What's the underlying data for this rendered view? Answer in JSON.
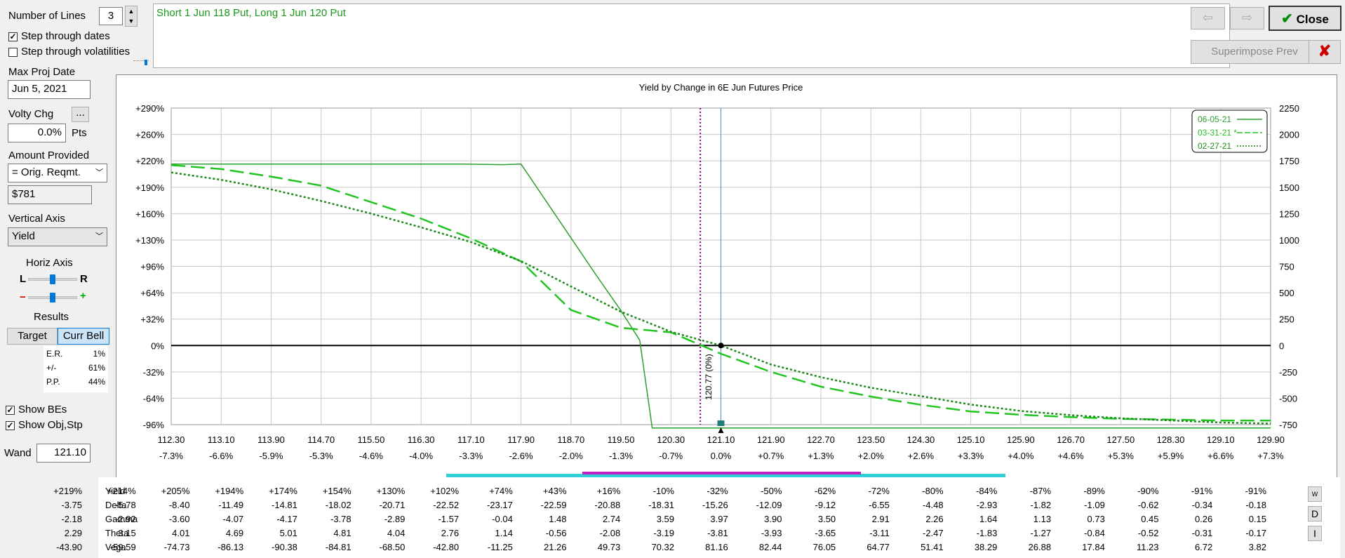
{
  "controls": {
    "num_lines_label": "Number of Lines",
    "num_lines_value": "3",
    "step_dates_label": "Step through dates",
    "step_dates_checked": true,
    "step_vols_label": "Step through volatilities",
    "step_vols_checked": false,
    "max_proj_date_label": "Max Proj Date",
    "max_proj_date_value": "Jun 5, 2021",
    "volty_chg_label": "Volty Chg",
    "volty_btn_label": "...",
    "volty_value": "0.0%",
    "volty_unit": "Pts",
    "amount_label": "Amount Provided",
    "amount_select": "= Orig. Reqmt.",
    "amount_value": "$781",
    "vaxis_label": "Vertical Axis",
    "vaxis_select": "Yield",
    "haxis_label": "Horiz Axis",
    "haxis_left": "L",
    "haxis_right": "R",
    "zoom_minus": "−",
    "zoom_plus": "+",
    "results_label": "Results",
    "target_btn": "Target",
    "curr_bell_btn": "Curr Bell",
    "er_label": "E.R.",
    "er_value": "1%",
    "pm_label": "+/-",
    "pm_value": "61%",
    "pp_label": "P.P.",
    "pp_value": "44%",
    "show_bes_label": "Show BEs",
    "show_bes_checked": true,
    "show_obj_label": "Show Obj,Stp",
    "show_obj_checked": true,
    "wand_label": "Wand",
    "wand_value": "121.10"
  },
  "position_text": "Short 1 Jun 118 Put, Long 1 Jun 120 Put",
  "toolbar": {
    "back_icon": "arrow-left-icon",
    "fwd_icon": "arrow-right-icon",
    "close_label": "Close",
    "close_icon": "checkmark-icon",
    "superimpose_label": "Superimpose Prev",
    "cancel_icon": "red-x-icon"
  },
  "chart_data": {
    "type": "line",
    "title": "Yield by Change in 6E Jun Futures Price",
    "x_ticks": [
      "112.30",
      "113.10",
      "113.90",
      "114.70",
      "115.50",
      "116.30",
      "117.10",
      "117.90",
      "118.70",
      "119.50",
      "120.30",
      "121.10",
      "121.90",
      "122.70",
      "123.50",
      "124.30",
      "125.10",
      "125.90",
      "126.70",
      "127.50",
      "128.30",
      "129.10",
      "129.90"
    ],
    "x_pct_ticks": [
      "-7.3%",
      "-6.6%",
      "-5.9%",
      "-5.3%",
      "-4.6%",
      "-4.0%",
      "-3.3%",
      "-2.6%",
      "-2.0%",
      "-1.3%",
      "-0.7%",
      "0.0%",
      "+0.7%",
      "+1.3%",
      "+2.0%",
      "+2.6%",
      "+3.3%",
      "+4.0%",
      "+4.6%",
      "+5.3%",
      "+5.9%",
      "+6.6%",
      "+7.3%"
    ],
    "y_left_ticks": [
      "+290%",
      "+260%",
      "+220%",
      "+190%",
      "+160%",
      "+130%",
      "+96%",
      "+64%",
      "+32%",
      "0%",
      "-32%",
      "-64%",
      "-96%"
    ],
    "y_right_ticks": [
      "2250",
      "2000",
      "1750",
      "1500",
      "1250",
      "1000",
      "750",
      "500",
      "250",
      "0",
      "-250",
      "-500",
      "-750"
    ],
    "xlim": [
      112.3,
      129.9
    ],
    "ylim_dollars": [
      -750,
      2250
    ],
    "grid": true,
    "legend_position": "top-right",
    "series": [
      {
        "name": "06-05-21",
        "style": "solid",
        "color": "#2e9e2e",
        "x": [
          112.3,
          116.0,
          117.0,
          117.6,
          117.9,
          118.3,
          118.7,
          119.1,
          119.5,
          119.8,
          120.0,
          121.1,
          129.9
        ],
        "y": [
          1719,
          1719,
          1719,
          1714,
          1719,
          1370,
          1020,
          670,
          330,
          50,
          -781,
          -781,
          -781
        ]
      },
      {
        "name": "03-31-21 *",
        "style": "dashed",
        "color": "#22c422",
        "x": [
          112.3,
          113.1,
          113.9,
          114.7,
          115.5,
          116.3,
          117.1,
          117.9,
          118.7,
          119.5,
          120.3,
          121.1,
          121.9,
          122.7,
          123.5,
          124.3,
          125.1,
          125.9,
          126.7,
          127.5,
          128.3,
          129.1,
          129.9
        ],
        "y": [
          1710,
          1672,
          1601,
          1515,
          1359,
          1203,
          1015,
          797,
          336,
          168,
          125,
          -78,
          -250,
          -390,
          -484,
          -562,
          -625,
          -656,
          -679,
          -695,
          -703,
          -711,
          -711
        ]
      },
      {
        "name": "02-27-21",
        "style": "dotted",
        "color": "#1a8a1a",
        "x": [
          112.3,
          113.1,
          113.9,
          114.7,
          115.5,
          116.3,
          117.1,
          117.9,
          118.7,
          119.5,
          120.3,
          121.1,
          121.9,
          122.7,
          123.5,
          124.3,
          125.1,
          125.9,
          126.7,
          127.5,
          128.3,
          129.1,
          129.9
        ],
        "y": [
          1640,
          1570,
          1480,
          1370,
          1250,
          1120,
          980,
          800,
          560,
          320,
          130,
          0,
          -180,
          -300,
          -400,
          -480,
          -560,
          -620,
          -660,
          -690,
          -710,
          -730,
          -740
        ]
      }
    ],
    "break_even_label": "120.77 (0%)",
    "break_even_x": 120.77,
    "current_x": 121.1
  },
  "greeks": {
    "row_labels": [
      "Yield",
      "Delta",
      "Gamma",
      "Theta",
      "Vega"
    ],
    "yield": [
      "+219%",
      "+214%",
      "+205%",
      "+194%",
      "+174%",
      "+154%",
      "+130%",
      "+102%",
      "+74%",
      "+43%",
      "+16%",
      "-10%",
      "-32%",
      "-50%",
      "-62%",
      "-72%",
      "-80%",
      "-84%",
      "-87%",
      "-89%",
      "-90%",
      "-91%",
      "-91%"
    ],
    "delta": [
      "-3.75",
      "-5.78",
      "-8.40",
      "-11.49",
      "-14.81",
      "-18.02",
      "-20.71",
      "-22.52",
      "-23.17",
      "-22.59",
      "-20.88",
      "-18.31",
      "-15.26",
      "-12.09",
      "-9.12",
      "-6.55",
      "-4.48",
      "-2.93",
      "-1.82",
      "-1.09",
      "-0.62",
      "-0.34",
      "-0.18"
    ],
    "gamma": [
      "-2.18",
      "-2.92",
      "-3.60",
      "-4.07",
      "-4.17",
      "-3.78",
      "-2.89",
      "-1.57",
      "-0.04",
      "1.48",
      "2.74",
      "3.59",
      "3.97",
      "3.90",
      "3.50",
      "2.91",
      "2.26",
      "1.64",
      "1.13",
      "0.73",
      "0.45",
      "0.26",
      "0.15"
    ],
    "theta": [
      "2.29",
      "3.15",
      "4.01",
      "4.69",
      "5.01",
      "4.81",
      "4.04",
      "2.76",
      "1.14",
      "-0.56",
      "-2.08",
      "-3.19",
      "-3.81",
      "-3.93",
      "-3.65",
      "-3.11",
      "-2.47",
      "-1.83",
      "-1.27",
      "-0.84",
      "-0.52",
      "-0.31",
      "-0.17"
    ],
    "vega": [
      "-43.90",
      "-59.59",
      "-74.73",
      "-86.13",
      "-90.38",
      "-84.81",
      "-68.50",
      "-42.80",
      "-11.25",
      "21.26",
      "49.73",
      "70.32",
      "81.16",
      "82.44",
      "76.05",
      "64.77",
      "51.41",
      "38.29",
      "26.88",
      "17.84",
      "11.23",
      "6.72",
      "3.82"
    ],
    "side_buttons": [
      "W",
      "D",
      "I"
    ]
  }
}
